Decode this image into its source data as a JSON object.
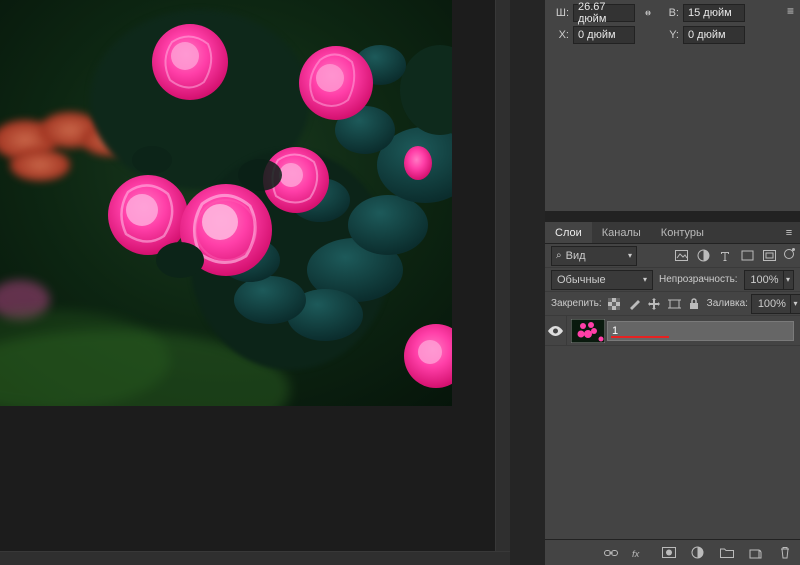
{
  "properties": {
    "w_label": "Ш:",
    "w_value": "26.67 дюйм",
    "h_label": "В:",
    "h_value": "15 дюйм",
    "x_label": "X:",
    "x_value": "0 дюйм",
    "y_label": "Y:",
    "y_value": "0 дюйм"
  },
  "layers_panel": {
    "tabs": {
      "layers": "Слои",
      "channels": "Каналы",
      "paths": "Контуры"
    },
    "search_kind": "Вид",
    "blend_mode": "Обычные",
    "opacity_label": "Непрозрачность:",
    "opacity_value": "100%",
    "lock_label": "Закрепить:",
    "fill_label": "Заливка:",
    "fill_value": "100%",
    "layer_name_editing": "1"
  }
}
